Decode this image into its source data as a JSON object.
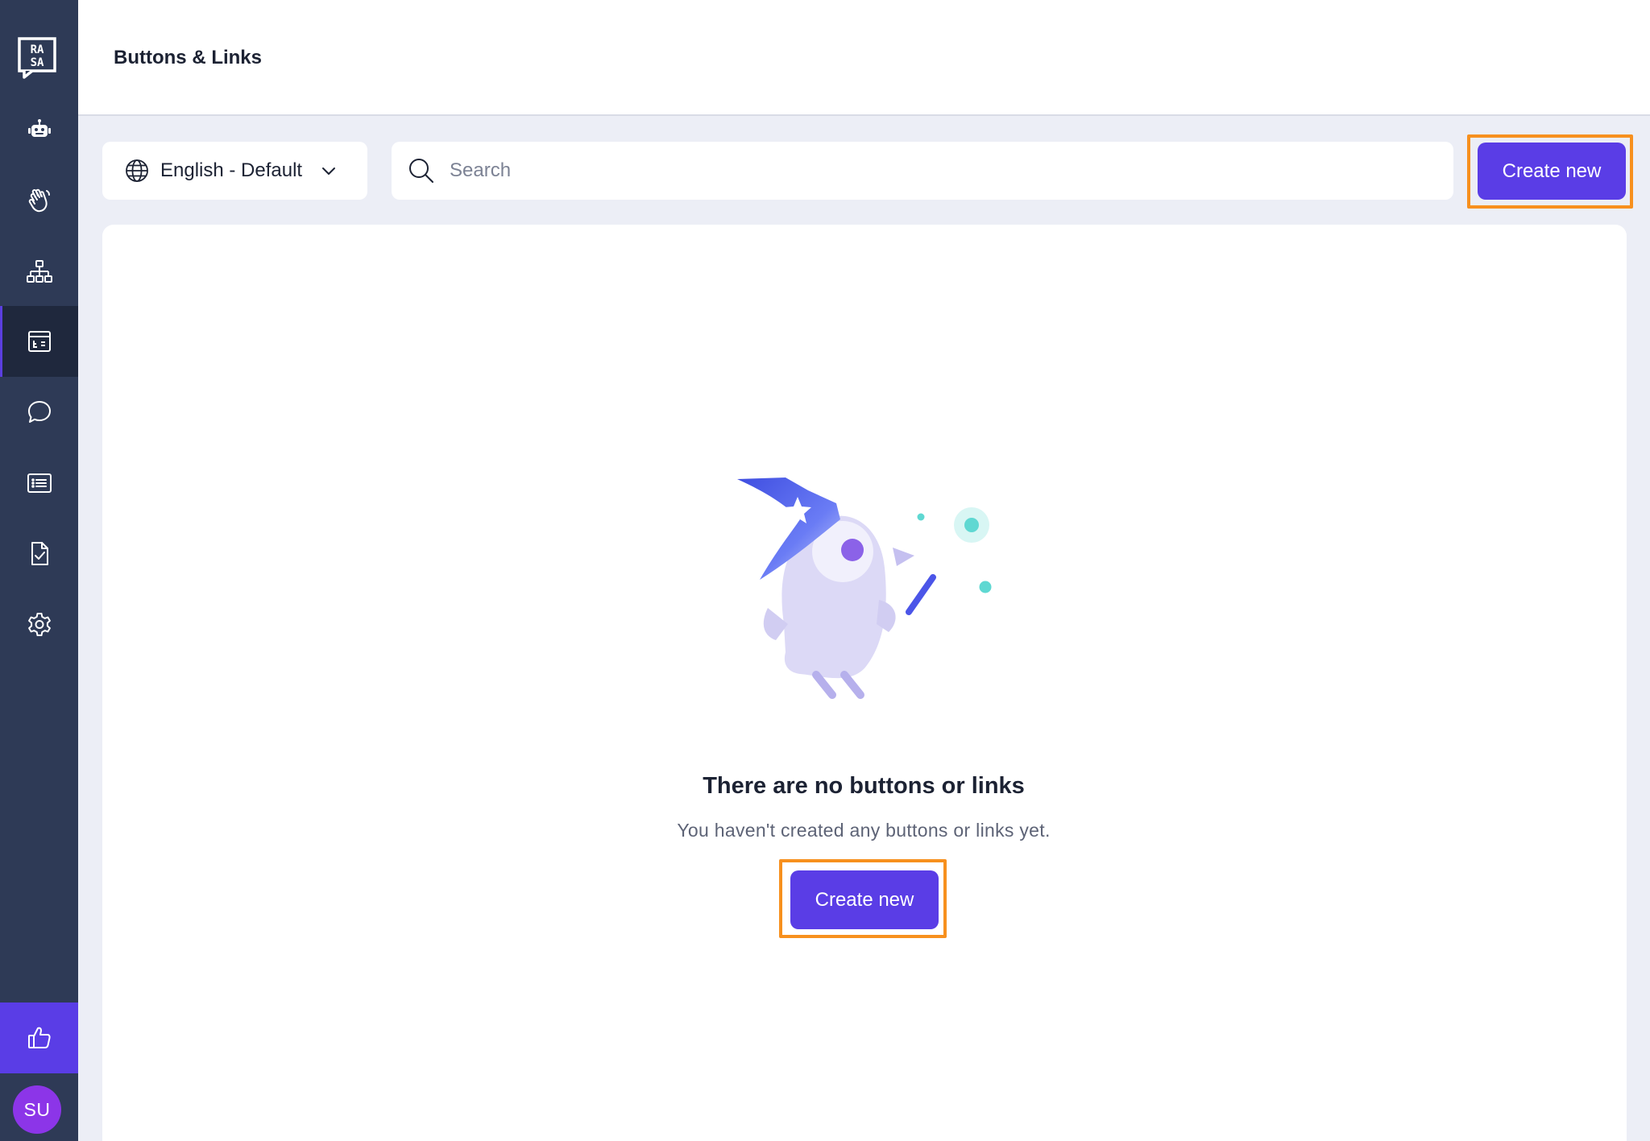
{
  "sidebar": {
    "logo_icon": "rasa-logo",
    "items": [
      {
        "icon": "robot-icon",
        "active": false
      },
      {
        "icon": "wave-hand-icon",
        "active": false
      },
      {
        "icon": "hierarchy-icon",
        "active": false
      },
      {
        "icon": "responses-icon",
        "active": true
      },
      {
        "icon": "chat-bubble-icon",
        "active": false
      },
      {
        "icon": "list-icon",
        "active": false
      },
      {
        "icon": "document-check-icon",
        "active": false
      },
      {
        "icon": "gear-icon",
        "active": false
      }
    ],
    "feedback_icon": "thumbs-up-icon",
    "avatar_initials": "SU"
  },
  "header": {
    "title": "Buttons & Links"
  },
  "toolbar": {
    "language": "English - Default",
    "search_placeholder": "Search",
    "create_label": "Create new"
  },
  "empty_state": {
    "title": "There are no buttons or links",
    "subtitle": "You haven't created any buttons or links yet.",
    "create_label": "Create new"
  },
  "colors": {
    "sidebar": "#2e3a56",
    "primary": "#5a3de6",
    "highlight": "#f7901e",
    "background": "#eceef6"
  }
}
